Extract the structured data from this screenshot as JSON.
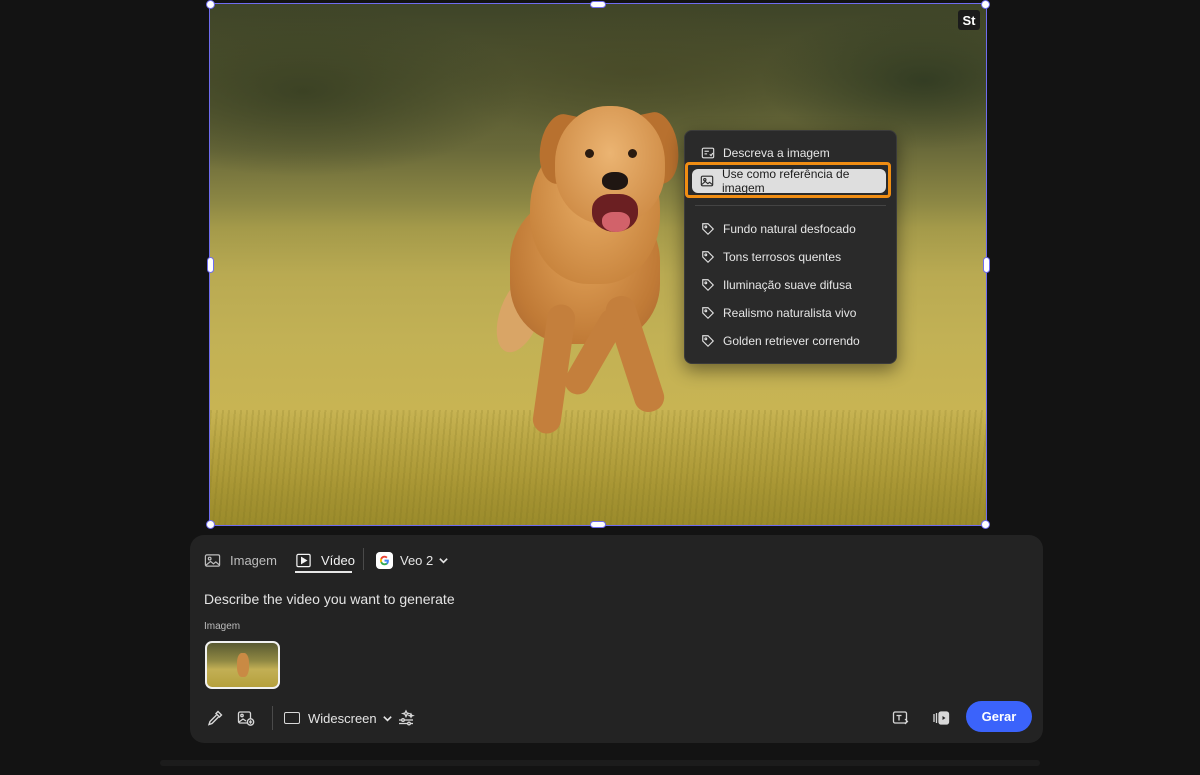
{
  "canvas": {
    "stock_badge": "St"
  },
  "context_menu": {
    "actions": [
      {
        "label": "Descreva a imagem",
        "icon": "describe-image-icon"
      },
      {
        "label": "Use como referência de imagem",
        "icon": "image-reference-icon",
        "highlighted": true
      }
    ],
    "tags": [
      {
        "label": "Fundo natural desfocado",
        "icon": "tag-icon"
      },
      {
        "label": "Tons terrosos quentes",
        "icon": "tag-icon"
      },
      {
        "label": "Iluminação suave difusa",
        "icon": "tag-icon"
      },
      {
        "label": "Realismo naturalista vivo",
        "icon": "tag-icon"
      },
      {
        "label": "Golden retriever correndo",
        "icon": "tag-icon"
      }
    ],
    "highlight_color": "#f08d13"
  },
  "prompt_panel": {
    "tabs": [
      {
        "label": "Imagem",
        "icon": "image-icon",
        "active": false
      },
      {
        "label": "Vídeo",
        "icon": "video-icon",
        "active": true
      }
    ],
    "model": {
      "label": "Veo 2",
      "icon": "google-icon"
    },
    "prompt_placeholder": "Describe the video you want to generate",
    "image_section_label": "Imagem",
    "aspect_ratio": "Widescreen",
    "generate_label": "Gerar",
    "accent_color": "#3b63fb",
    "tool_icons": [
      "eyedropper-icon",
      "add-image-icon",
      "effects-icon",
      "text-to-image-icon",
      "media-icon"
    ]
  }
}
